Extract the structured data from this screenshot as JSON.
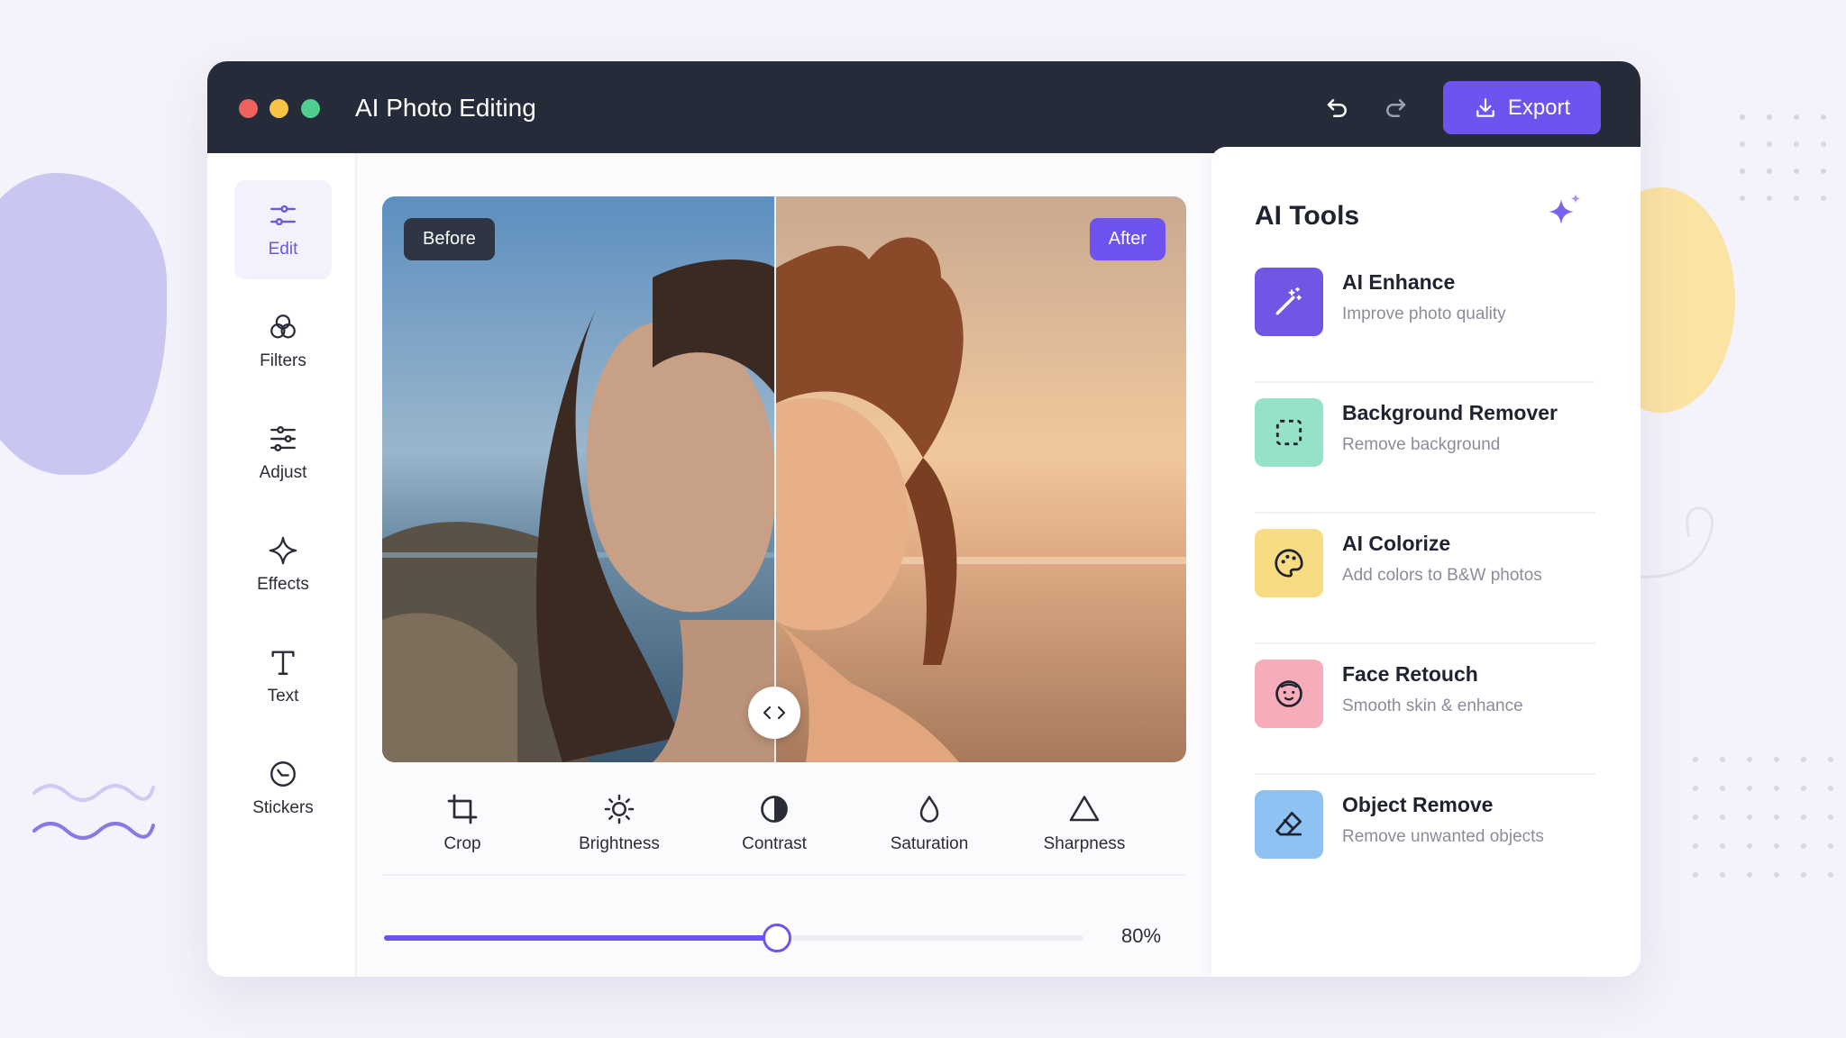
{
  "app": {
    "title": "AI Photo Editing",
    "export_label": "Export",
    "undo_icon": "undo-icon",
    "redo_icon": "redo-icon"
  },
  "sidebar": {
    "items": [
      {
        "label": "Edit",
        "icon": "sliders-icon",
        "active": true
      },
      {
        "label": "Filters",
        "icon": "filters-icon",
        "active": false
      },
      {
        "label": "Adjust",
        "icon": "adjust-icon",
        "active": false
      },
      {
        "label": "Effects",
        "icon": "sparkle-icon",
        "active": false
      },
      {
        "label": "Text",
        "icon": "text-icon",
        "active": false
      },
      {
        "label": "Stickers",
        "icon": "sticker-icon",
        "active": false
      }
    ]
  },
  "preview": {
    "before_label": "Before",
    "after_label": "After",
    "split_position": 0.49
  },
  "tools": [
    {
      "label": "Crop",
      "icon": "crop-icon"
    },
    {
      "label": "Brightness",
      "icon": "sun-icon"
    },
    {
      "label": "Contrast",
      "icon": "contrast-icon"
    },
    {
      "label": "Saturation",
      "icon": "drop-icon"
    },
    {
      "label": "Sharpness",
      "icon": "triangle-icon"
    }
  ],
  "slider": {
    "value": 0.56,
    "value_label": "80%"
  },
  "ai_tools": {
    "title": "AI Tools",
    "items": [
      {
        "name": "AI Enhance",
        "desc": "Improve photo quality",
        "icon": "magic-wand-icon",
        "color": "#7156e6"
      },
      {
        "name": "Background Remover",
        "desc": "Remove background",
        "icon": "selection-icon",
        "color": "#95e2c6"
      },
      {
        "name": "AI Colorize",
        "desc": "Add colors to B&W photos",
        "icon": "palette-icon",
        "color": "#f8dc84"
      },
      {
        "name": "Face Retouch",
        "desc": "Smooth skin & enhance",
        "icon": "face-icon",
        "color": "#f6adb9"
      },
      {
        "name": "Object Remove",
        "desc": "Remove unwanted objects",
        "icon": "eraser-icon",
        "color": "#8dc2f2"
      }
    ]
  },
  "colors": {
    "accent": "#6e53f0",
    "titlebar": "#252b38"
  }
}
